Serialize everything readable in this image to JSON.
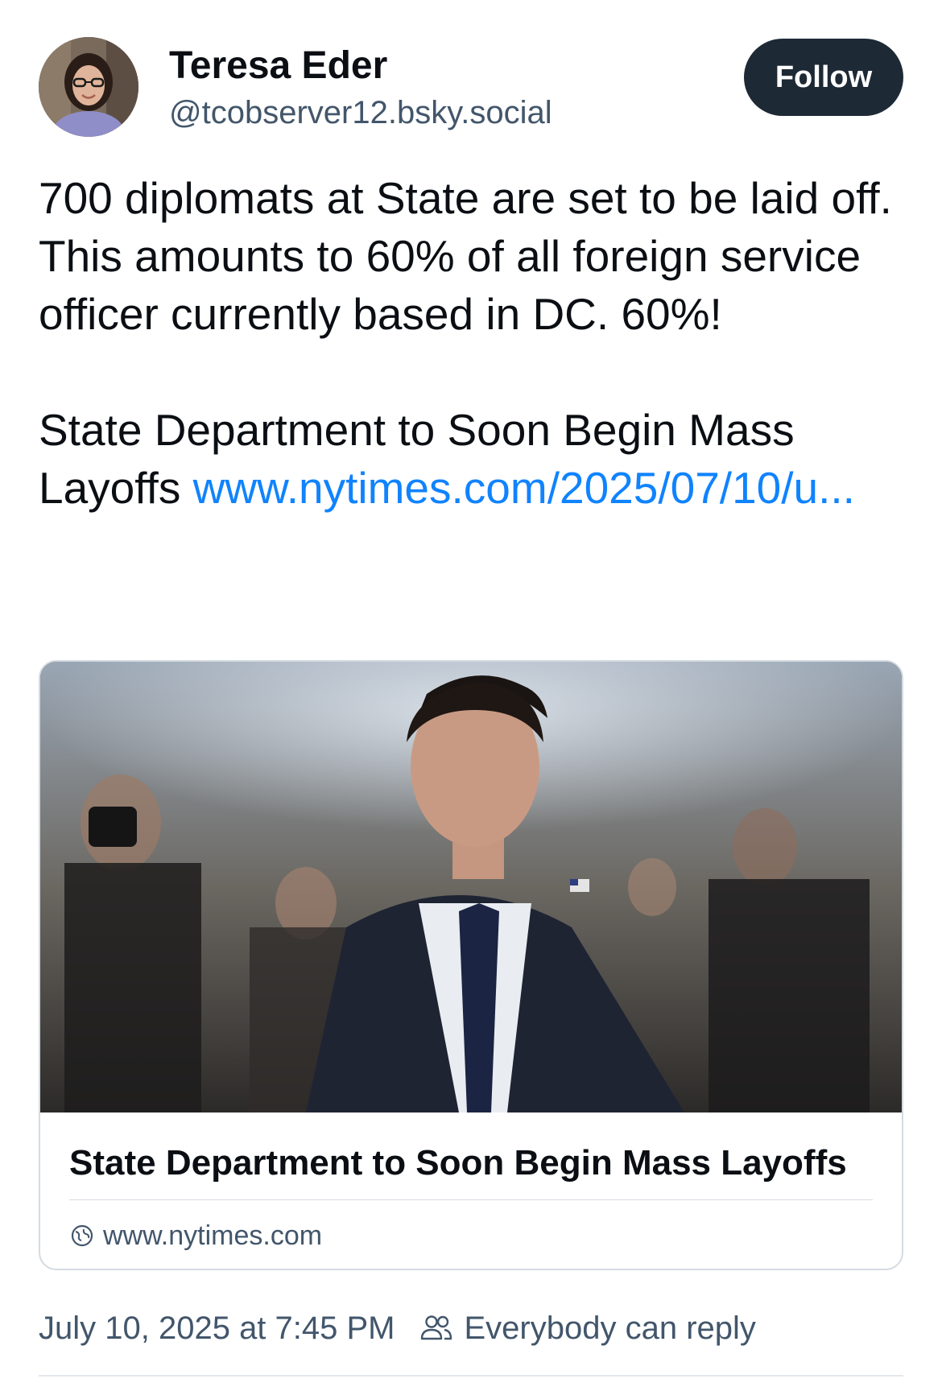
{
  "author": {
    "display_name": "Teresa Eder",
    "handle": "@tcobserver12.bsky.social",
    "avatar_icon": "profile-photo"
  },
  "follow_button": {
    "label": "Follow",
    "bg_color": "#1e2936"
  },
  "post": {
    "paragraph1": "700 diplomats at State are set to be laid off. This amounts to 60% of all foreign service officer currently based in DC. 60%!",
    "paragraph2_text": "State Department to Soon Begin Mass Layoffs ",
    "link_text": "www.nytimes.com/2025/07/10/u...",
    "link_color": "#1083fe"
  },
  "link_card": {
    "image_alt_icon": "news-photo",
    "title": "State Department to Soon Begin Mass Layoffs",
    "domain": "www.nytimes.com",
    "domain_icon": "globe-icon"
  },
  "meta": {
    "timestamp": "July 10, 2025 at 7:45 PM",
    "reply_setting": "Everybody can reply",
    "reply_icon": "people-icon"
  },
  "colors": {
    "text_primary": "#0b0f14",
    "text_secondary": "#42566b",
    "border": "#d4dbe2"
  }
}
